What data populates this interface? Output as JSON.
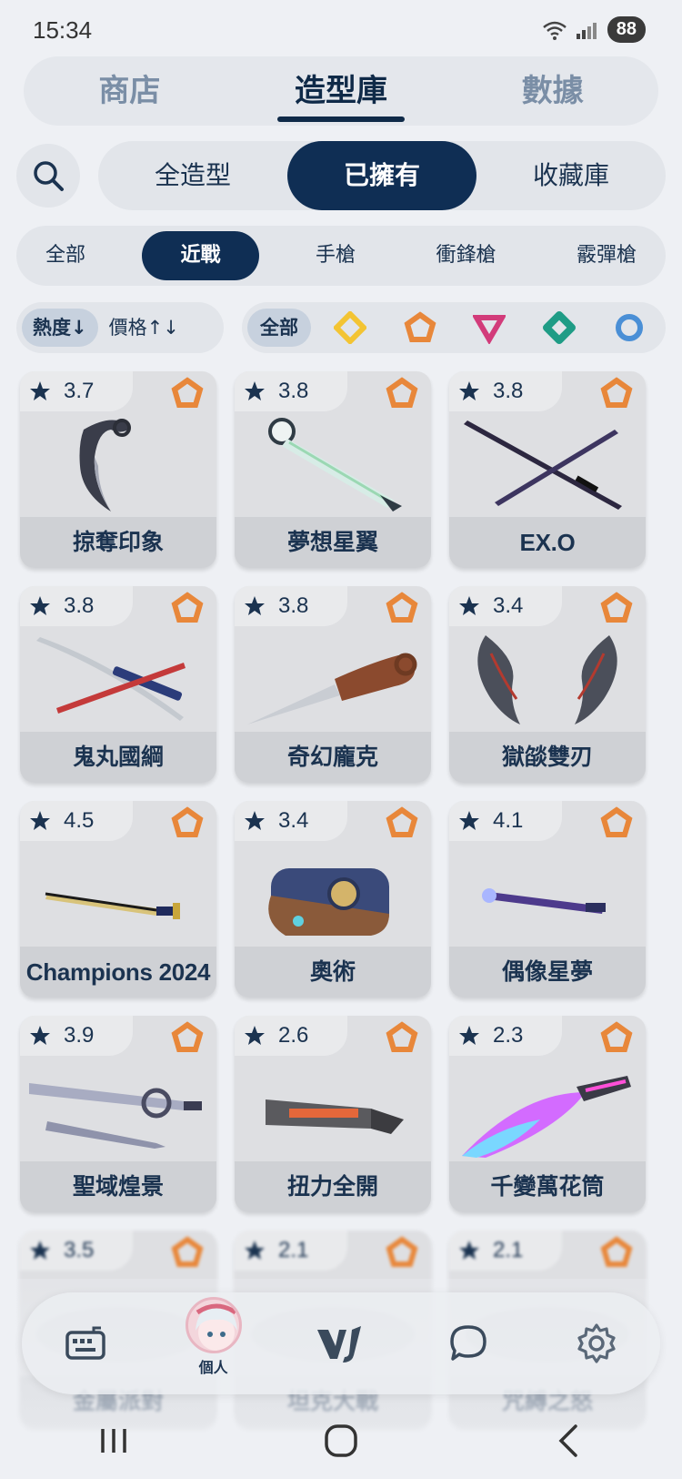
{
  "status": {
    "time": "15:34",
    "battery": "88",
    "wifi_badge": "5"
  },
  "top_tabs": [
    {
      "label": "商店",
      "active": false
    },
    {
      "label": "造型庫",
      "active": true
    },
    {
      "label": "數據",
      "active": false
    }
  ],
  "collection_tabs": [
    {
      "label": "全造型",
      "active": false
    },
    {
      "label": "已擁有",
      "active": true
    },
    {
      "label": "收藏庫",
      "active": false
    }
  ],
  "weapon_tabs": [
    {
      "label": "全部",
      "active": false
    },
    {
      "label": "近戰",
      "active": true
    },
    {
      "label": "手槍",
      "active": false
    },
    {
      "label": "衝鋒槍",
      "active": false
    },
    {
      "label": "霰彈槍",
      "active": false
    }
  ],
  "sort": {
    "heat_label": "熱度↓",
    "price_label": "價格↑↓"
  },
  "tier_filter": {
    "all_label": "全部",
    "tiers": [
      {
        "icon": "diamond-tier-icon",
        "color": "#f3c433"
      },
      {
        "icon": "pentagon-tier-icon",
        "color": "#e8873a"
      },
      {
        "icon": "triangle-tier-icon",
        "color": "#d23b7a"
      },
      {
        "icon": "rhombus-tier-icon",
        "color": "#1f9c86"
      },
      {
        "icon": "circle-tier-icon",
        "color": "#4a8fd6"
      }
    ]
  },
  "skins": [
    {
      "rating": "3.7",
      "name": "掠奪印象",
      "tier_color": "#e8873a",
      "art": "karambit"
    },
    {
      "rating": "3.8",
      "name": "夢想星翼",
      "tier_color": "#e8873a",
      "art": "wand"
    },
    {
      "rating": "3.8",
      "name": "EX.O",
      "tier_color": "#e8873a",
      "art": "dual-blades"
    },
    {
      "rating": "3.8",
      "name": "鬼丸國綱",
      "tier_color": "#e8873a",
      "art": "katana"
    },
    {
      "rating": "3.8",
      "name": "奇幻龐克",
      "tier_color": "#e8873a",
      "art": "kunai"
    },
    {
      "rating": "3.4",
      "name": "獄燄雙刃",
      "tier_color": "#e8873a",
      "art": "twin-scythes"
    },
    {
      "rating": "4.5",
      "name": "Champions 2024",
      "tier_color": "#e8873a",
      "art": "sword"
    },
    {
      "rating": "3.4",
      "name": "奧術",
      "tier_color": "#e8873a",
      "art": "gauntlet"
    },
    {
      "rating": "4.1",
      "name": "偶像星夢",
      "tier_color": "#e8873a",
      "art": "baton"
    },
    {
      "rating": "3.9",
      "name": "聖域煌景",
      "tier_color": "#e8873a",
      "art": "twin-swords"
    },
    {
      "rating": "2.6",
      "name": "扭力全開",
      "tier_color": "#e8873a",
      "art": "bayonet"
    },
    {
      "rating": "2.3",
      "name": "千變萬花筒",
      "tier_color": "#e8873a",
      "art": "neon-blade"
    },
    {
      "rating": "3.5",
      "name": "金屬派對",
      "tier_color": "#e8873a",
      "art": "blurred"
    },
    {
      "rating": "2.1",
      "name": "坦克大戰",
      "tier_color": "#e8873a",
      "art": "blurred"
    },
    {
      "rating": "2.1",
      "name": "咒縛之怒",
      "tier_color": "#e8873a",
      "art": "blurred"
    }
  ],
  "bottom_nav": {
    "items": [
      {
        "icon": "keyboard-icon",
        "label": ""
      },
      {
        "icon": "avatar",
        "label": "個人"
      },
      {
        "icon": "vj-logo-icon",
        "label": ""
      },
      {
        "icon": "chat-icon",
        "label": ""
      },
      {
        "icon": "gear-icon",
        "label": ""
      }
    ]
  },
  "colors": {
    "primary": "#0f2e54",
    "text": "#1b3350",
    "background": "#eef0f4",
    "tier_orange": "#e8873a"
  }
}
